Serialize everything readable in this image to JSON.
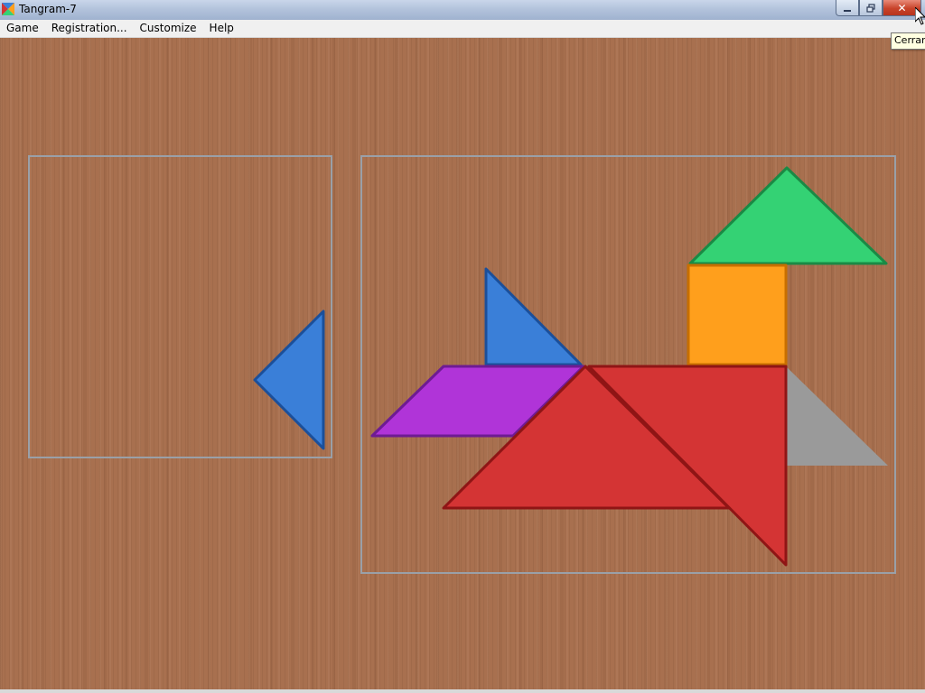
{
  "window": {
    "title": "Tangram-7",
    "icon": "tangram-app-icon",
    "controls": {
      "minimize_icon": "minimize-icon",
      "maximize_icon": "maximize-icon",
      "close_icon": "close-icon",
      "close_glyph": "✕"
    }
  },
  "menu": {
    "items": [
      {
        "label": "Game"
      },
      {
        "label": "Registration..."
      },
      {
        "label": "Customize"
      },
      {
        "label": "Help"
      }
    ]
  },
  "tooltip": {
    "text": "Cerrar"
  },
  "board": {
    "background": "wood-texture",
    "frame_color": "#9aa0a8"
  },
  "pieces": {
    "large_triangle_color": "#d43434",
    "large_triangle_edge": "#8f1515",
    "medium_triangle_color": "#34d274",
    "medium_triangle_edge": "#1a8a45",
    "square_color": "#ff9f1c",
    "square_edge": "#c86f00",
    "small_triangle_color": "#3a7fd8",
    "small_triangle_edge": "#1b4f9a",
    "parallelogram_color": "#b034d8",
    "parallelogram_edge": "#6e1b93",
    "silhouette_color": "#9a9a9a"
  }
}
